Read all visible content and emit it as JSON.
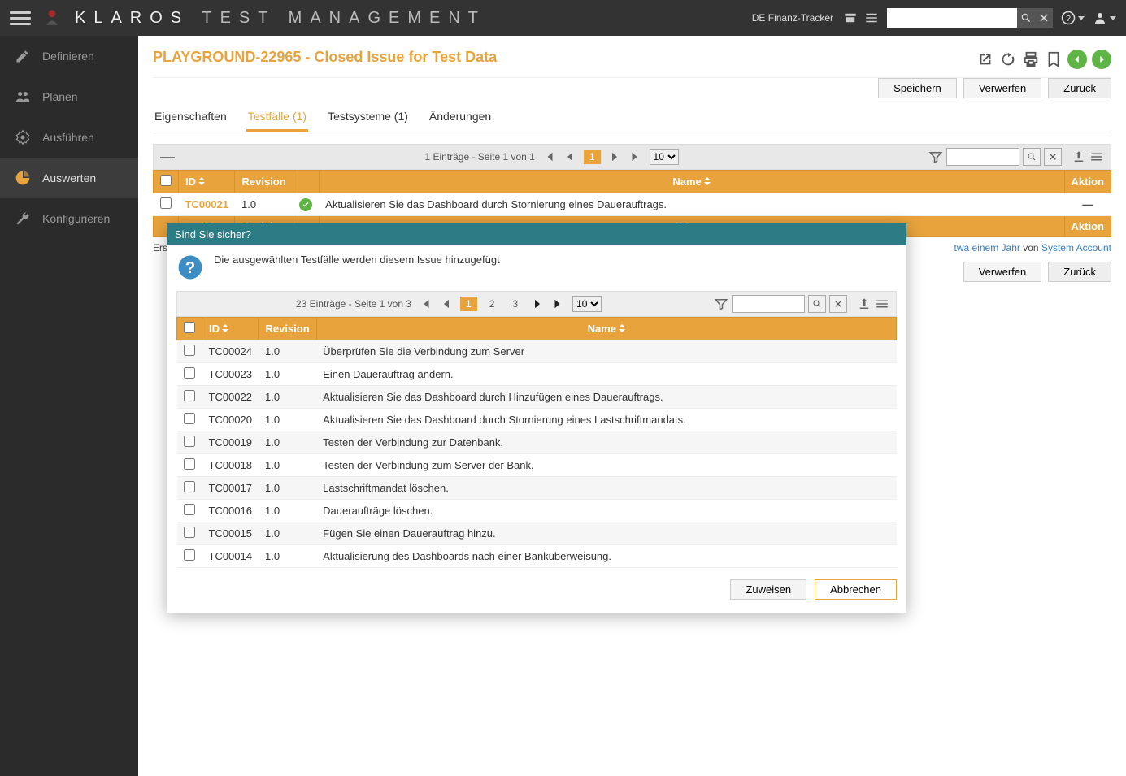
{
  "brand": {
    "bold": "KLAROS",
    "light": "TEST MANAGEMENT"
  },
  "topbar": {
    "project": "DE Finanz-Tracker"
  },
  "sidebar": {
    "items": [
      {
        "label": "Definieren"
      },
      {
        "label": "Planen"
      },
      {
        "label": "Ausführen"
      },
      {
        "label": "Auswerten"
      },
      {
        "label": "Konfigurieren"
      }
    ]
  },
  "page": {
    "title": "PLAYGROUND-22965 - Closed Issue for Test Data"
  },
  "buttons": {
    "save": "Speichern",
    "discard": "Verwerfen",
    "back": "Zurück",
    "assign": "Zuweisen",
    "cancel": "Abbrechen"
  },
  "tabs": {
    "properties": "Eigenschaften",
    "testcases": "Testfälle (1)",
    "testsystems": "Testsysteme (1)",
    "changes": "Änderungen"
  },
  "table": {
    "cols": {
      "id": "ID",
      "revision": "Revision",
      "name": "Name",
      "action": "Aktion"
    },
    "pager": "1 Einträge - Seite 1 von 1",
    "page": "1",
    "pageSize": "10",
    "rows": [
      {
        "id": "TC00021",
        "rev": "1.0",
        "name": "Aktualisieren Sie das Dashboard durch Stornierung eines Dauerauftrags."
      }
    ]
  },
  "meta": {
    "prefix": "Ers",
    "ago": "twa einem Jahr",
    "by": "von",
    "user": "System Account"
  },
  "modal": {
    "title": "Sind Sie sicher?",
    "message": "Die ausgewählten Testfälle werden diesem Issue hinzugefügt",
    "pager": "23 Einträge - Seite 1 von 3",
    "pages": {
      "p1": "1",
      "p2": "2",
      "p3": "3"
    },
    "pageSize": "10",
    "rows": [
      {
        "id": "TC00024",
        "rev": "1.0",
        "name": "Überprüfen Sie die Verbindung zum Server"
      },
      {
        "id": "TC00023",
        "rev": "1.0",
        "name": "Einen Dauerauftrag ändern."
      },
      {
        "id": "TC00022",
        "rev": "1.0",
        "name": "Aktualisieren Sie das Dashboard durch Hinzufügen eines Dauerauftrags."
      },
      {
        "id": "TC00020",
        "rev": "1.0",
        "name": "Aktualisieren Sie das Dashboard durch Stornierung eines Lastschriftmandats."
      },
      {
        "id": "TC00019",
        "rev": "1.0",
        "name": "Testen der Verbindung zur Datenbank."
      },
      {
        "id": "TC00018",
        "rev": "1.0",
        "name": "Testen der Verbindung zum Server der Bank."
      },
      {
        "id": "TC00017",
        "rev": "1.0",
        "name": "Lastschriftmandat löschen."
      },
      {
        "id": "TC00016",
        "rev": "1.0",
        "name": "Daueraufträge löschen."
      },
      {
        "id": "TC00015",
        "rev": "1.0",
        "name": "Fügen Sie einen Dauerauftrag hinzu."
      },
      {
        "id": "TC00014",
        "rev": "1.0",
        "name": "Aktualisierung des Dashboards nach einer Banküberweisung."
      }
    ]
  }
}
